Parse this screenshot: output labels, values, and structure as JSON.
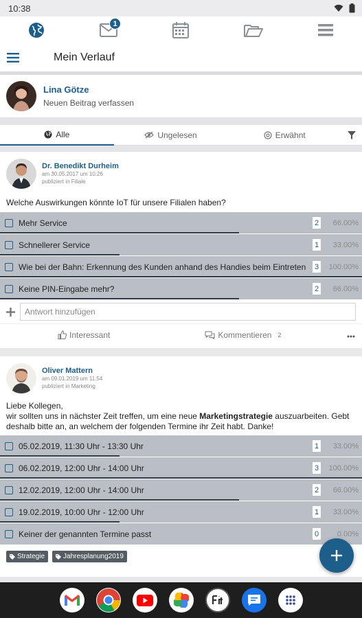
{
  "status_bar": {
    "time": "10:38",
    "wifi_icon": "wifi-icon",
    "battery_icon": "battery-icon"
  },
  "top_nav": [
    {
      "name": "globe",
      "icon": "globe-icon"
    },
    {
      "name": "messages",
      "icon": "envelope-icon",
      "badge": "1"
    },
    {
      "name": "calendar",
      "icon": "calendar-icon"
    },
    {
      "name": "folder",
      "icon": "folder-icon"
    },
    {
      "name": "menu",
      "icon": "list-icon"
    }
  ],
  "app_bar": {
    "title": "Mein Verlauf"
  },
  "composer": {
    "name": "Lina Götze",
    "placeholder": "Neuen Beitrag verfassen"
  },
  "filters": {
    "all": "Alle",
    "unread": "Ungelesen",
    "mentioned": "Erwähnt"
  },
  "post1": {
    "author": "Dr. Benedikt Durheim",
    "date": "am 30.05.2017 um 10:26",
    "published": "publiziert in Filiale",
    "question": "Welche Auswirkungen könnte IoT für unsere Filialen haben?",
    "options": [
      {
        "label": "Mehr Service",
        "count": "2",
        "pct": "66.00%",
        "fraction": 0.66
      },
      {
        "label": "Schnellerer Service",
        "count": "1",
        "pct": "33.00%",
        "fraction": 0.33
      },
      {
        "label": "Wie bei der Bahn: Erkennung des Kunden anhand des Handies beim Eintreten",
        "count": "3",
        "pct": "100.00%",
        "fraction": 1.0
      },
      {
        "label": "Keine PIN-Eingabe mehr?",
        "count": "2",
        "pct": "66.00%",
        "fraction": 0.66
      }
    ],
    "answer_placeholder": "Antwort hinzufügen",
    "like_label": "Interessant",
    "comment_label": "Kommentieren",
    "comment_count": "2"
  },
  "post2": {
    "author": "Oliver Mattern",
    "date": "am 09.01.2019 um 11:54",
    "published": "publiziert in Marketing",
    "text_line1": "Liebe Kollegen,",
    "text_line2_a": "wir sollten uns in nächster Zeit treffen, um eine neue ",
    "text_line2_bold": "Marketingstrategie",
    "text_line2_b": " auszuarbeiten. Gebt deshalb bitte an, an welchem der folgenden Termine ihr Zeit habt. Danke!",
    "options": [
      {
        "label": "05.02.2019, 11:30 Uhr - 13:30 Uhr",
        "count": "1",
        "pct": "33.00%",
        "fraction": 0.33
      },
      {
        "label": "06.02.2019, 12:00 Uhr - 14:00 Uhr",
        "count": "3",
        "pct": "100.00%",
        "fraction": 1.0
      },
      {
        "label": "12.02.2019, 12:00 Uhr - 14:00 Uhr",
        "count": "2",
        "pct": "66.00%",
        "fraction": 0.66
      },
      {
        "label": "19.02.2019, 10:00 Uhr - 12:00 Uhr",
        "count": "1",
        "pct": "33.00%",
        "fraction": 0.33
      },
      {
        "label": "Keiner der genannten Termine passt",
        "count": "0",
        "pct": "0.00%",
        "fraction": 0.0
      }
    ],
    "tags": [
      "Strategie",
      "Jahresplanung2019"
    ]
  },
  "dock_apps": [
    "gmail-icon",
    "chrome-icon",
    "youtube-icon",
    "photos-icon",
    "fit-icon",
    "messages-icon",
    "app-drawer-icon"
  ]
}
